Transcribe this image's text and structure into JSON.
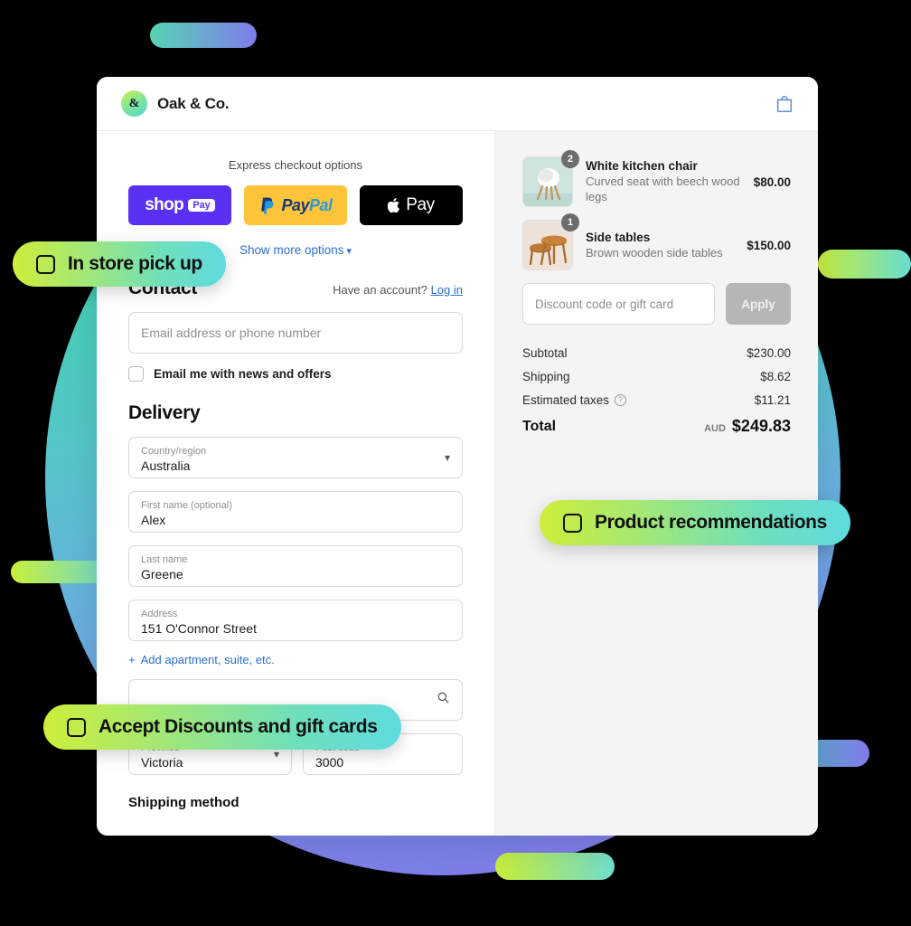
{
  "header": {
    "brand_mark": "&",
    "brand_name": "Oak & Co.",
    "cart_icon": "shopping-bag-icon"
  },
  "express": {
    "label": "Express checkout options",
    "buttons": [
      {
        "id": "shop-pay",
        "word": "shop",
        "chip": "Pay",
        "bg": "#5a31f4"
      },
      {
        "id": "paypal",
        "word_a": "Pay",
        "word_b": "Pal",
        "bg": "#ffc43a"
      },
      {
        "id": "apple-pay",
        "word": "Pay",
        "bg": "#000000"
      }
    ],
    "show_more": "Show more options",
    "chevron": "⌄"
  },
  "contact": {
    "title": "Contact",
    "account_prompt": "Have an account?",
    "login_link": "Log in",
    "email_placeholder": "Email address or phone number",
    "newsletter_label": "Email me with news and offers"
  },
  "delivery": {
    "title": "Delivery",
    "fields": [
      {
        "label": "Country/region",
        "value": "Australia",
        "type": "select"
      },
      {
        "label": "First name (optional)",
        "value": "Alex",
        "type": "text"
      },
      {
        "label": "Last name",
        "value": "Greene",
        "type": "text"
      },
      {
        "label": "Address",
        "value": "151 O'Connor Street",
        "type": "search"
      }
    ],
    "add_apartment": "Add apartment, suite, etc.",
    "plus": "+",
    "province": {
      "label": "Province",
      "value": "Victoria"
    },
    "postcode": {
      "label": "Post code",
      "value": "3000"
    },
    "shipping_method_title": "Shipping method"
  },
  "summary": {
    "items": [
      {
        "title": "White kitchen chair",
        "desc": "Curved seat with beech wood legs",
        "price": "$80.00",
        "qty": "2"
      },
      {
        "title": "Side tables",
        "desc": "Brown wooden side tables",
        "price": "$150.00",
        "qty": "1"
      }
    ],
    "discount_placeholder": "Discount code or gift card",
    "apply_label": "Apply",
    "totals": [
      {
        "label": "Subtotal",
        "value": "$230.00"
      },
      {
        "label": "Shipping",
        "value": "$8.62"
      },
      {
        "label": "Estimated taxes",
        "value": "$11.21",
        "info": "?"
      }
    ],
    "grand": {
      "label": "Total",
      "currency": "AUD",
      "amount": "$249.83"
    }
  },
  "callouts": [
    {
      "id": "pickup",
      "text": "In store pick up",
      "icon": "checkbox-outline-icon"
    },
    {
      "id": "discounts",
      "text": "Accept Discounts and gift cards",
      "icon": "checkbox-outline-icon"
    },
    {
      "id": "recommendations",
      "text": "Product recommendations",
      "icon": "checkbox-outline-icon"
    }
  ],
  "colors": {
    "accent_link": "#2b6ed8",
    "badge_gradient_start": "#ceee3a",
    "badge_gradient_end": "#5fdbe0",
    "circle_top": "#3fd0b0",
    "circle_bottom": "#8076ea"
  }
}
